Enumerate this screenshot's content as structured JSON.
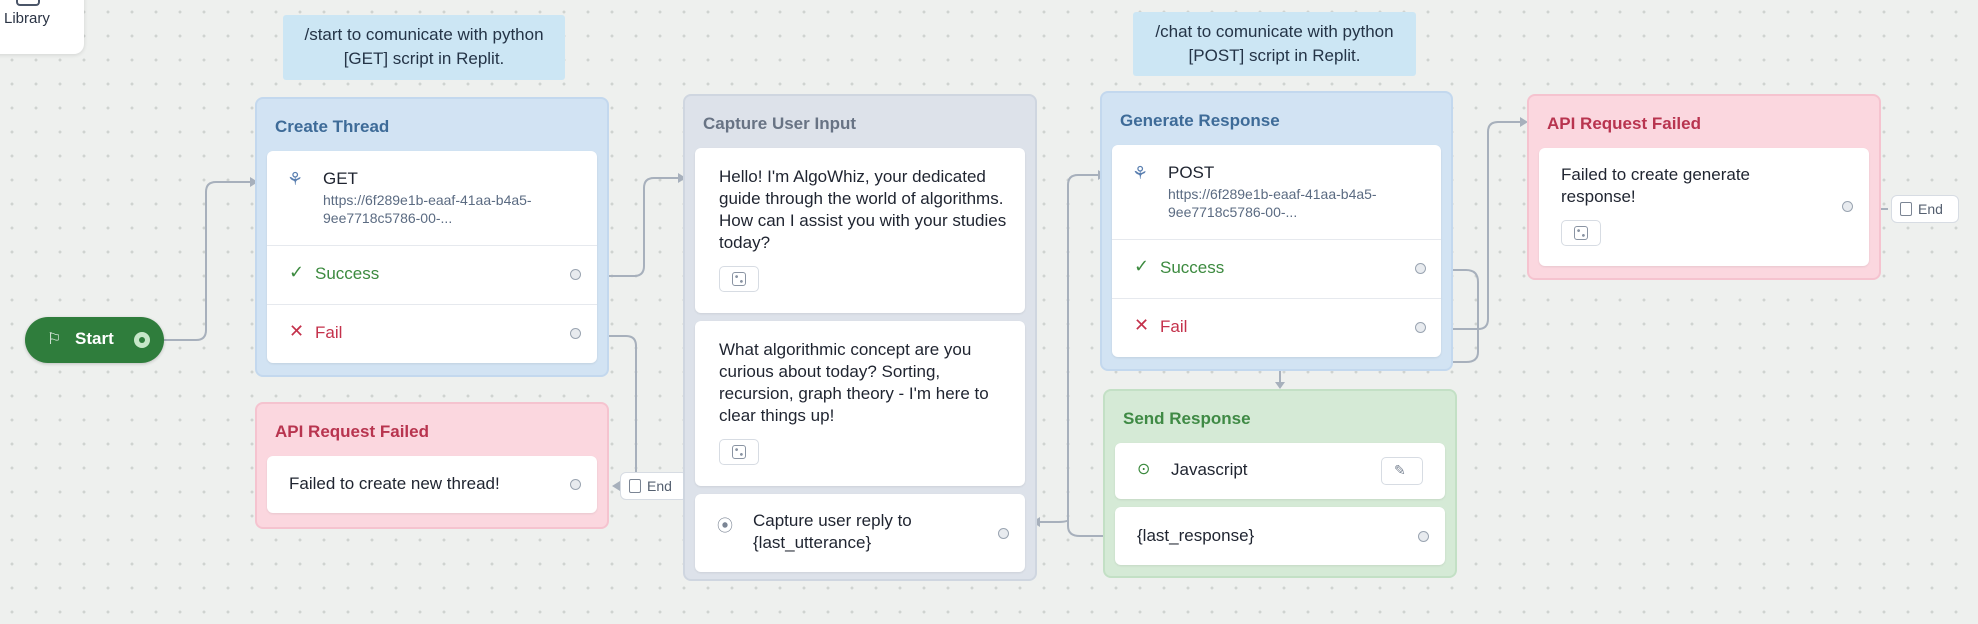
{
  "library": {
    "label": "Library"
  },
  "notes": {
    "get": "/start to comunicate with python [GET] script in Replit.",
    "post": "/chat to comunicate with python [POST] script in Replit."
  },
  "start": {
    "label": "Start"
  },
  "create_thread": {
    "title": "Create Thread",
    "method": "GET",
    "url": "https://6f289e1b-eaaf-41aa-b4a5-9ee7718c5786-00-...",
    "success": "Success",
    "fail": "Fail"
  },
  "api_failed_1": {
    "title": "API Request Failed",
    "message": "Failed to create new thread!",
    "end": "End"
  },
  "capture": {
    "title": "Capture User Input",
    "message1": "Hello! I'm AlgoWhiz, your dedicated guide through the world of algorithms. How can I assist you with your studies today?",
    "message2": "What algorithmic concept are you curious about today? Sorting, recursion, graph theory - I'm here to clear things up!",
    "capture_text": "Capture user reply to {last_utterance}"
  },
  "generate": {
    "title": "Generate Response",
    "method": "POST",
    "url": "https://6f289e1b-eaaf-41aa-b4a5-9ee7718c5786-00-...",
    "success": "Success",
    "fail": "Fail"
  },
  "api_failed_2": {
    "title": "API Request Failed",
    "message": "Failed to create generate response!",
    "end": "End"
  },
  "send": {
    "title": "Send Response",
    "javascript": "Javascript",
    "response": "{last_response}"
  },
  "colors": {
    "start": "#2f7d3c",
    "success": "#3c8a3f",
    "fail": "#c4314b",
    "blue_block": "#d2e3f3",
    "pink_block": "#fbd7df",
    "green_block": "#d5ead6"
  }
}
